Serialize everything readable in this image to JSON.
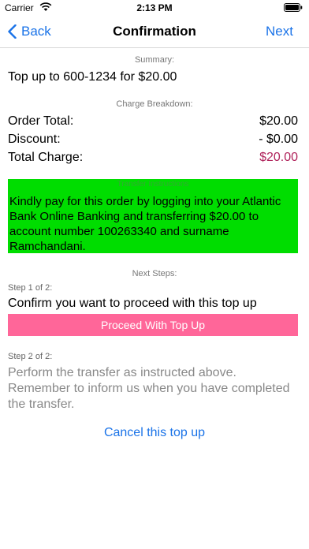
{
  "status_bar": {
    "carrier": "Carrier",
    "time": "2:13 PM"
  },
  "nav": {
    "back_label": "Back",
    "title": "Confirmation",
    "next_label": "Next"
  },
  "summary": {
    "label": "Summary:",
    "text": "Top up to 600-1234 for $20.00"
  },
  "charge_breakdown": {
    "label": "Charge Breakdown:",
    "rows": [
      {
        "label": "Order Total:",
        "value": "$20.00"
      },
      {
        "label": "Discount:",
        "value": "- $0.00"
      },
      {
        "label": "Total Charge:",
        "value": "$20.00"
      }
    ]
  },
  "transfer": {
    "header": "Transfer Instructions",
    "text": "Kindly pay for this order by logging into your Atlantic Bank Online Banking and transferring $20.00 to account number 100263340 and surname Ramchandani."
  },
  "next_steps": {
    "label": "Next Steps:",
    "step1_label": "Step 1 of 2:",
    "step1_text": "Confirm you want to proceed with this top up",
    "proceed_button": "Proceed With Top Up",
    "step2_label": "Step 2 of 2:",
    "step2_text": "Perform the transfer as instructed above. Remember to inform us when you have completed the transfer."
  },
  "cancel_label": "Cancel this top up",
  "colors": {
    "accent": "#1a73e8",
    "green_box": "#00dd00",
    "proceed_button": "#ff6699",
    "total_charge": "#b0245c"
  }
}
